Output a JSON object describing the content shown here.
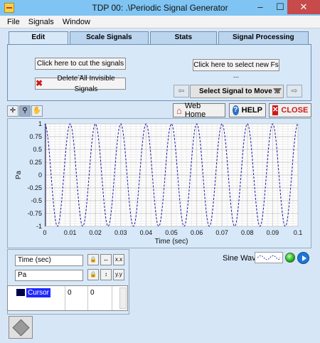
{
  "window": {
    "title": "TDP 00: .\\Periodic Signal Generator",
    "minimize": "–",
    "maximize": "☐",
    "close": "✕"
  },
  "menu": [
    "File",
    "Signals",
    "Window"
  ],
  "tabs": [
    {
      "label": "Edit",
      "active": true
    },
    {
      "label": "Scale Signals",
      "active": false
    },
    {
      "label": "Stats",
      "active": false
    },
    {
      "label": "Signal Processing",
      "active": false
    }
  ],
  "edit": {
    "cut_button": "Click here to cut the signals ...",
    "fs_button": "Click here to select new Fs ...",
    "delete_button": "Delete All Invisible Signals",
    "select_move": "Select Signal to Move ...",
    "prev_arrow": "⇦",
    "next_arrow": "⇨"
  },
  "toolbar": {
    "web_home": "Web Home",
    "help": "HELP",
    "close": "CLOSE"
  },
  "chart_data": {
    "type": "line",
    "title": "",
    "xlabel": "Time (sec)",
    "ylabel": "Pa",
    "xlim": [
      0,
      0.1
    ],
    "ylim": [
      -1,
      1
    ],
    "x_ticks": [
      "0",
      "0.01",
      "0.02",
      "0.03",
      "0.04",
      "0.05",
      "0.06",
      "0.07",
      "0.08",
      "0.09",
      "0.1"
    ],
    "y_ticks": [
      "1",
      "0.75",
      "0.5",
      "0.25",
      "0",
      "-0.25",
      "-0.5",
      "-0.75",
      "-1"
    ],
    "grid": true,
    "series": [
      {
        "name": "Sine Wave",
        "color": "#1a1aa6",
        "style": "dashed",
        "frequency_hz": 100,
        "amplitude": 1,
        "phase_deg": 90
      }
    ]
  },
  "scales": {
    "x_name": "Time (sec)",
    "y_name": "Pa"
  },
  "cursor": {
    "name": "Cursor",
    "x": "0",
    "y": "0"
  },
  "legend": {
    "label": "Sine Wave"
  }
}
